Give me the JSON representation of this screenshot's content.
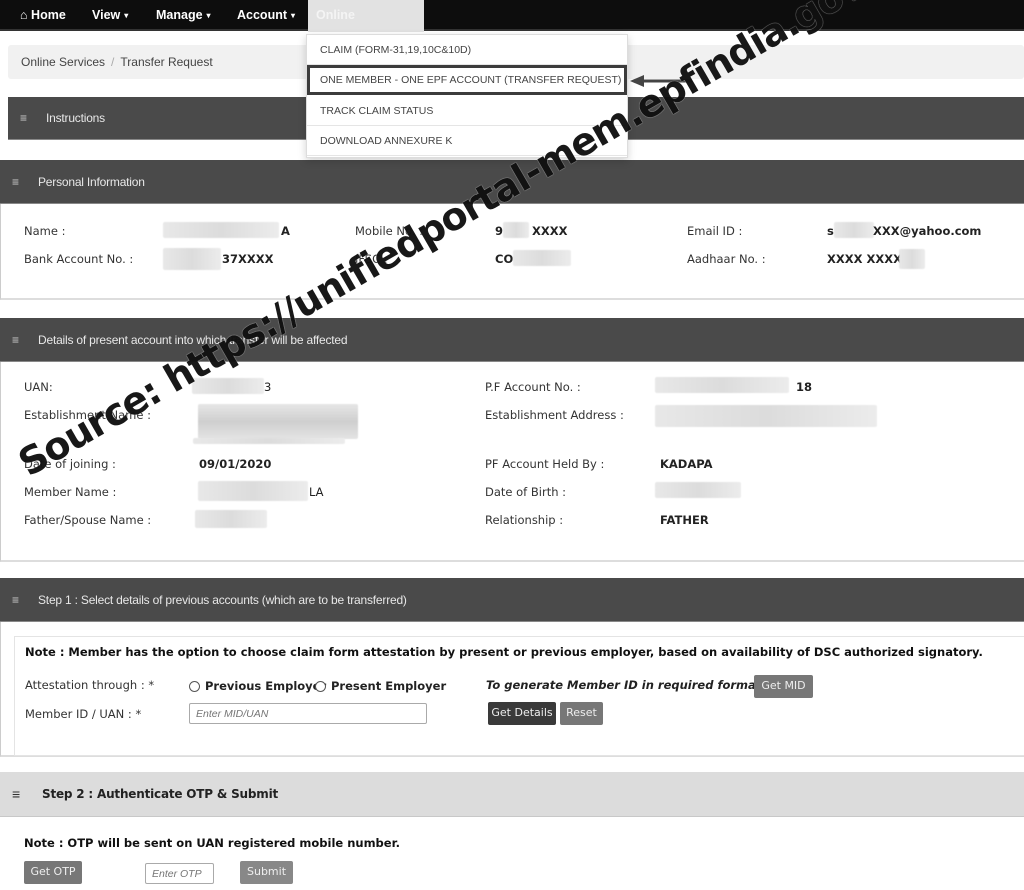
{
  "nav": {
    "home": "Home",
    "view": "View",
    "manage": "Manage",
    "account": "Account",
    "online_services": "Online Services",
    "caret": "▾",
    "home_icon": "⌂"
  },
  "breadcrumb": {
    "items": [
      "Online Services",
      "Transfer Request"
    ],
    "separator": "/"
  },
  "dropdown": {
    "items": [
      "CLAIM (FORM-31,19,10C&10D)",
      "ONE MEMBER - ONE EPF ACCOUNT (TRANSFER REQUEST)",
      "TRACK CLAIM STATUS",
      "DOWNLOAD ANNEXURE K"
    ],
    "highlighted_index": 1
  },
  "sections": {
    "instructions": {
      "title": "Instructions",
      "icon": "≡"
    },
    "personal": {
      "title": "Personal Information",
      "icon": "≡",
      "fields": {
        "name_label": "Name :",
        "name_value": "A",
        "mobile_label": "Mobile No. :",
        "mobile_value_prefix": "9",
        "mobile_value_suffix": "XXXX",
        "email_label": "Email ID :",
        "email_value_prefix": "s",
        "email_value_suffix": "XXX@yahoo.com",
        "bank_label": "Bank Account No. :",
        "bank_value": "37XXXX",
        "ifsc_label": "IFSC :",
        "ifsc_value": "COI",
        "aadhaar_label": "Aadhaar No. :",
        "aadhaar_value": "XXXX XXXX 1"
      }
    },
    "present": {
      "title": "Details of present account into which transfer will be affected",
      "icon": "≡",
      "fields": {
        "uan_label": "UAN:",
        "uan_value": "3",
        "pf_account_label": "P.F Account No. :",
        "pf_account_value": "18",
        "est_name_label": "Establishment Name :",
        "est_address_label": "Establishment Address :",
        "doj_label": "Date of joining :",
        "doj_value": "09/01/2020",
        "held_by_label": "PF Account Held By :",
        "held_by_value": "KADAPA",
        "member_name_label": "Member Name :",
        "member_name_value": "LA",
        "dob_label": "Date of Birth :",
        "father_label": "Father/Spouse Name :",
        "relationship_label": "Relationship :",
        "relationship_value": "FATHER"
      }
    },
    "step1": {
      "title": "Step 1 : Select details of previous accounts (which are to be transferred)",
      "icon": "≡",
      "note": "Note : Member has the option to choose claim form attestation by present or previous employer, based on availability of DSC authorized signatory.",
      "attestation_label": "Attestation through : *",
      "radio_previous": "Previous Employer",
      "radio_present": "Present Employer",
      "mid_hint": "To generate Member ID in required format, click",
      "get_mid": "Get MID",
      "member_label": "Member ID / UAN : *",
      "member_placeholder": "Enter MID/UAN",
      "get_details": "Get Details",
      "reset": "Reset"
    },
    "step2": {
      "title": "Step 2 : Authenticate OTP & Submit",
      "icon": "≡",
      "note": "Note : OTP will be sent on UAN registered mobile number.",
      "get_otp": "Get OTP",
      "otp_placeholder": "Enter OTP",
      "submit": "Submit"
    }
  },
  "watermark": "Source: https://unifiedportal-mem.epfindia.gov.in/memberinterface/"
}
